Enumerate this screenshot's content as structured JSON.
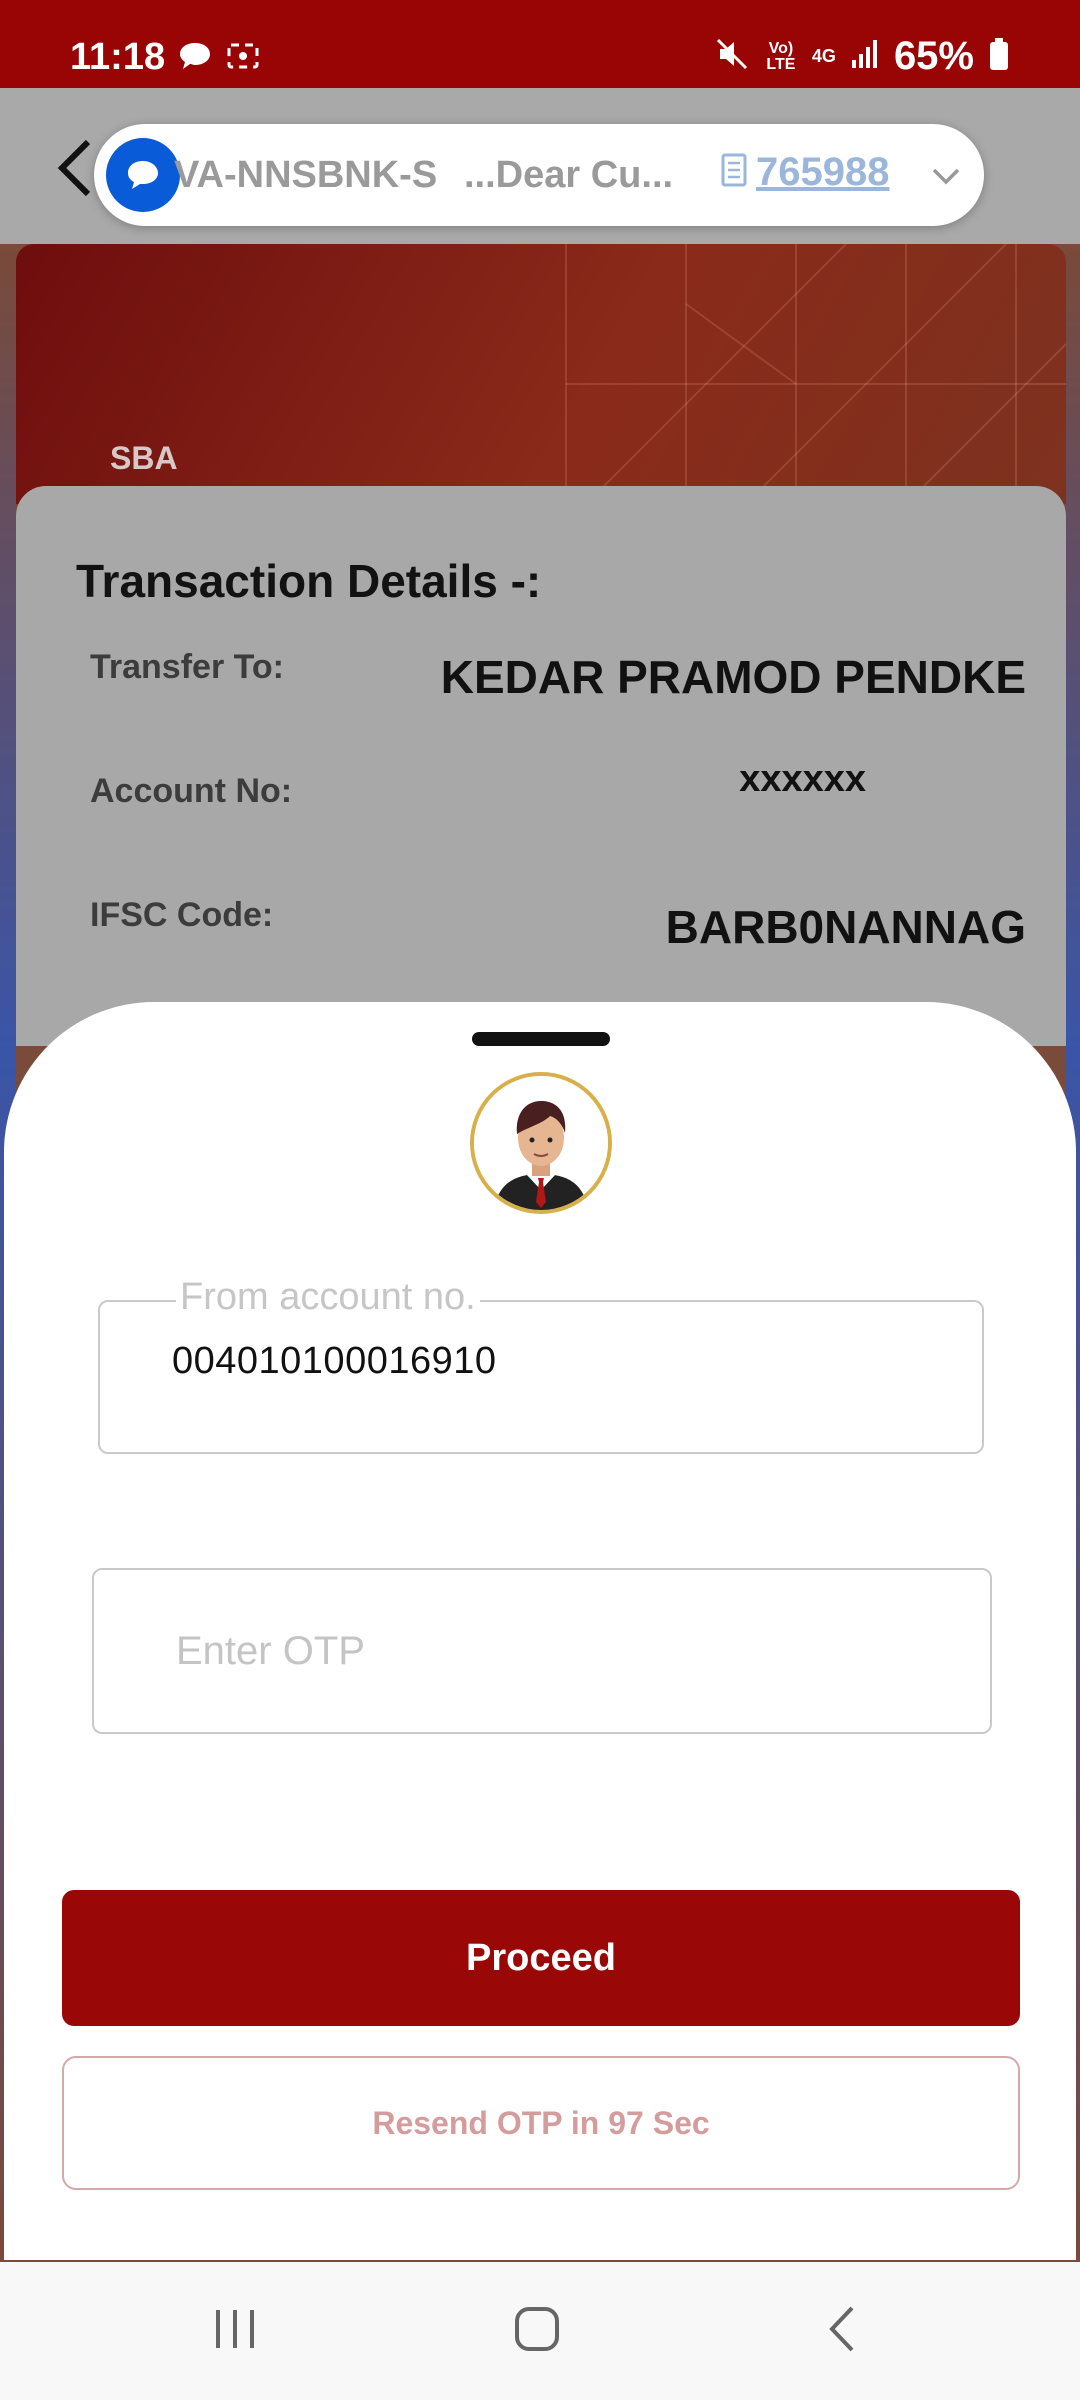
{
  "status_bar": {
    "time": "11:18",
    "battery_percent": "65%",
    "network_label": "4G",
    "volte_label": "Vo) LTE"
  },
  "notification": {
    "sender": "VA-NNSBNK-S",
    "preview": "...Dear Cu...",
    "code": "765988"
  },
  "card": {
    "account_type": "SBA"
  },
  "details": {
    "title": "Transaction Details -:",
    "rows": [
      {
        "label": "Transfer To:",
        "value": "KEDAR PRAMOD PENDKE"
      },
      {
        "label": "Account No:",
        "value": "xxxxxx"
      },
      {
        "label": "IFSC Code:",
        "value": "BARB0NANNAG"
      }
    ]
  },
  "sheet": {
    "from_account_label": "From account no.",
    "from_account_value": "004010100016910",
    "otp_placeholder": "Enter OTP",
    "proceed_label": "Proceed",
    "resend_label": "Resend OTP in 97 Sec"
  },
  "colors": {
    "brand_red": "#990707",
    "status_red": "#990404",
    "link_blue": "#9bb6da"
  },
  "icons": {
    "back": "arrow-left-icon",
    "sms": "chat-bubble-icon",
    "copy": "copy-icon",
    "expand": "chevron-down-icon",
    "mute": "mute-icon",
    "signal": "signal-icon",
    "battery": "battery-icon",
    "recent_apps": "recent-apps-icon",
    "home": "home-icon",
    "nav_back": "nav-back-icon"
  }
}
